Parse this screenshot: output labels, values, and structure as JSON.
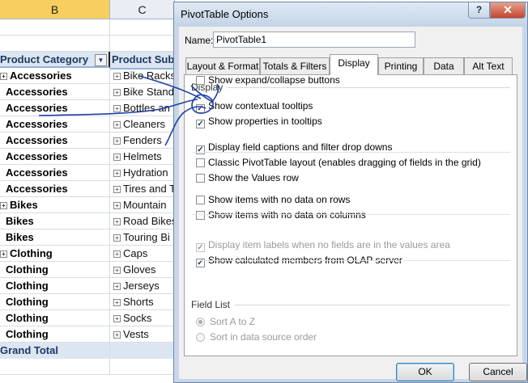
{
  "sheet": {
    "col_b": "B",
    "col_c": "C",
    "header": {
      "category": "Product Category",
      "subcategory": "Product Subc"
    },
    "rows": [
      {
        "category": "Accessories",
        "expand": "+",
        "sub": "Bike Racks"
      },
      {
        "category": "Accessories",
        "expand": "",
        "sub": "Bike Stand"
      },
      {
        "category": "Accessories",
        "expand": "",
        "sub": "Bottles an"
      },
      {
        "category": "Accessories",
        "expand": "",
        "sub": "Cleaners"
      },
      {
        "category": "Accessories",
        "expand": "",
        "sub": "Fenders"
      },
      {
        "category": "Accessories",
        "expand": "",
        "sub": "Helmets"
      },
      {
        "category": "Accessories",
        "expand": "",
        "sub": "Hydration"
      },
      {
        "category": "Accessories",
        "expand": "",
        "sub": "Tires and T"
      },
      {
        "category": "Bikes",
        "expand": "+",
        "sub": "Mountain"
      },
      {
        "category": "Bikes",
        "expand": "",
        "sub": "Road Bikes"
      },
      {
        "category": "Bikes",
        "expand": "",
        "sub": "Touring Bi"
      },
      {
        "category": "Clothing",
        "expand": "+",
        "sub": "Caps"
      },
      {
        "category": "Clothing",
        "expand": "",
        "sub": "Gloves"
      },
      {
        "category": "Clothing",
        "expand": "",
        "sub": "Jerseys"
      },
      {
        "category": "Clothing",
        "expand": "",
        "sub": "Shorts"
      },
      {
        "category": "Clothing",
        "expand": "",
        "sub": "Socks"
      },
      {
        "category": "Clothing",
        "expand": "",
        "sub": "Vests"
      }
    ],
    "grand_total": "Grand Total"
  },
  "dialog": {
    "title": "PivotTable Options",
    "help": "?",
    "close": "✕",
    "name_label": "Name:",
    "name_value": "PivotTable1",
    "tabs": [
      "Layout & Format",
      "Totals & Filters",
      "Display",
      "Printing",
      "Data",
      "Alt Text"
    ],
    "active_tab": "Display",
    "display_group": "Display",
    "options": [
      {
        "label": "Show expand/collapse buttons",
        "checked": false,
        "disabled": false
      },
      {
        "label": "Show contextual tooltips",
        "checked": true,
        "disabled": false
      },
      {
        "label": "Show properties in tooltips",
        "checked": true,
        "disabled": false
      },
      {
        "label": "Display field captions and filter drop downs",
        "checked": true,
        "disabled": false
      },
      {
        "label": "Classic PivotTable layout (enables dragging of fields in the grid)",
        "checked": false,
        "disabled": false
      },
      {
        "label": "Show the Values row",
        "checked": false,
        "disabled": false
      },
      {
        "label": "Show items with no data on rows",
        "checked": false,
        "disabled": false
      },
      {
        "label": "Show items with no data on columns",
        "checked": false,
        "disabled": false
      },
      {
        "label": "Display item labels when no fields are in the values area",
        "checked": true,
        "disabled": true
      },
      {
        "label": "Show calculated members from OLAP server",
        "checked": true,
        "disabled": false
      }
    ],
    "field_list_group": "Field List",
    "sort": [
      {
        "label": "Sort A to Z",
        "selected": true
      },
      {
        "label": "Sort in data source order",
        "selected": false
      }
    ],
    "ok": "OK",
    "cancel": "Cancel"
  },
  "colors": {
    "ink": "#1f3fa8",
    "selected_column": "#f8cf5f",
    "pivot_header": "#dce6f1"
  }
}
